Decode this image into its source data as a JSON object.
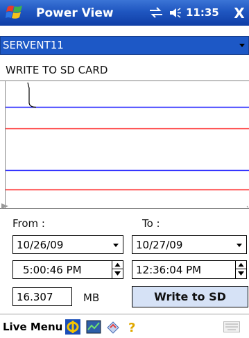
{
  "window": {
    "title": "Power View",
    "time": "11:35",
    "close_label": "X"
  },
  "device": {
    "selected": "SERVENT11"
  },
  "mode_label": "WRITE TO SD CARD",
  "chart_data": {
    "type": "line",
    "series": [
      {
        "color": "#1a1aff",
        "values": [
          0.2
        ]
      },
      {
        "color": "#ff1a1a",
        "values": [
          0.37
        ]
      },
      {
        "color": "#1a1aff",
        "values": [
          0.7
        ]
      },
      {
        "color": "#ff1a1a",
        "values": [
          0.85
        ]
      }
    ],
    "grid": false
  },
  "range": {
    "from_label": "From :",
    "to_label": "To :",
    "from_date": "10/26/09",
    "to_date": "10/27/09",
    "from_time": "5:00:46 PM",
    "to_time": "12:36:04 PM",
    "size_value": "16.307",
    "size_unit": "MB",
    "write_button": "Write to SD"
  },
  "menubar": {
    "label": "Live Menu"
  },
  "colors": {
    "titlebar": "#1f56c0",
    "dropdown": "#1d58c6",
    "button": "#d6e2f6"
  }
}
